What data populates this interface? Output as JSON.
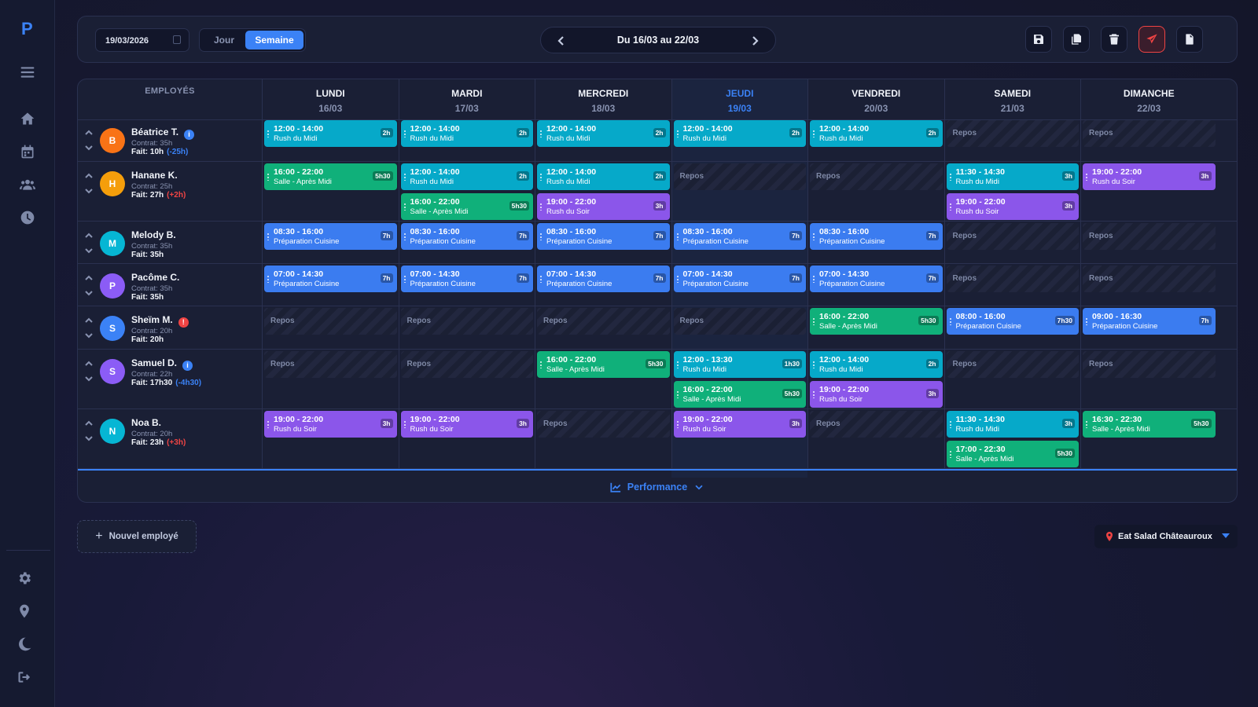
{
  "app": {
    "logo": "P"
  },
  "toolbar": {
    "date_value": "19/03/2026",
    "view_day": "Jour",
    "view_week": "Semaine",
    "week_range": "Du 16/03 au 22/03"
  },
  "grid": {
    "employees_header": "EMPLOYÉS",
    "days": [
      {
        "name": "LUNDI",
        "date": "16/03"
      },
      {
        "name": "MARDI",
        "date": "17/03"
      },
      {
        "name": "MERCREDI",
        "date": "18/03"
      },
      {
        "name": "JEUDI",
        "date": "19/03",
        "today": true
      },
      {
        "name": "VENDREDI",
        "date": "20/03"
      },
      {
        "name": "SAMEDI",
        "date": "21/03"
      },
      {
        "name": "DIMANCHE",
        "date": "22/03"
      }
    ],
    "repos_label": "Repos",
    "employees": [
      {
        "initial": "B",
        "name": "Béatrice T.",
        "badge": "info",
        "avatar_color": "#f97316",
        "contract": "Contrat: 35h",
        "done": "Fait: 10h",
        "diff": "(-25h)",
        "diff_type": "neg",
        "days": [
          [
            {
              "time": "12:00 - 14:00",
              "label": "Rush du Midi",
              "dur": "2h",
              "color": "cyan"
            }
          ],
          [
            {
              "time": "12:00 - 14:00",
              "label": "Rush du Midi",
              "dur": "2h",
              "color": "cyan"
            }
          ],
          [
            {
              "time": "12:00 - 14:00",
              "label": "Rush du Midi",
              "dur": "2h",
              "color": "cyan"
            }
          ],
          [
            {
              "time": "12:00 - 14:00",
              "label": "Rush du Midi",
              "dur": "2h",
              "color": "cyan"
            }
          ],
          [
            {
              "time": "12:00 - 14:00",
              "label": "Rush du Midi",
              "dur": "2h",
              "color": "cyan"
            }
          ],
          "repos",
          "repos"
        ]
      },
      {
        "initial": "H",
        "name": "Hanane K.",
        "badge": "",
        "avatar_color": "#f59e0b",
        "contract": "Contrat: 25h",
        "done": "Fait: 27h",
        "diff": "(+2h)",
        "diff_type": "pos",
        "days": [
          [
            {
              "time": "16:00 - 22:00",
              "label": "Salle - Après Midi",
              "dur": "5h30",
              "color": "green"
            }
          ],
          [
            {
              "time": "12:00 - 14:00",
              "label": "Rush du Midi",
              "dur": "2h",
              "color": "cyan"
            },
            {
              "time": "16:00 - 22:00",
              "label": "Salle - Après Midi",
              "dur": "5h30",
              "color": "green"
            }
          ],
          [
            {
              "time": "12:00 - 14:00",
              "label": "Rush du Midi",
              "dur": "2h",
              "color": "cyan"
            },
            {
              "time": "19:00 - 22:00",
              "label": "Rush du Soir",
              "dur": "3h",
              "color": "purple"
            }
          ],
          "repos",
          "repos",
          [
            {
              "time": "11:30 - 14:30",
              "label": "Rush du Midi",
              "dur": "3h",
              "color": "cyan"
            },
            {
              "time": "19:00 - 22:00",
              "label": "Rush du Soir",
              "dur": "3h",
              "color": "purple"
            }
          ],
          [
            {
              "time": "19:00 - 22:00",
              "label": "Rush du Soir",
              "dur": "3h",
              "color": "purple"
            }
          ]
        ]
      },
      {
        "initial": "M",
        "name": "Melody B.",
        "badge": "",
        "avatar_color": "#06b6d4",
        "contract": "Contrat: 35h",
        "done": "Fait: 35h",
        "diff": "",
        "diff_type": "",
        "days": [
          [
            {
              "time": "08:30 - 16:00",
              "label": "Préparation Cuisine",
              "dur": "7h",
              "color": "blue"
            }
          ],
          [
            {
              "time": "08:30 - 16:00",
              "label": "Préparation Cuisine",
              "dur": "7h",
              "color": "blue"
            }
          ],
          [
            {
              "time": "08:30 - 16:00",
              "label": "Préparation Cuisine",
              "dur": "7h",
              "color": "blue"
            }
          ],
          [
            {
              "time": "08:30 - 16:00",
              "label": "Préparation Cuisine",
              "dur": "7h",
              "color": "blue"
            }
          ],
          [
            {
              "time": "08:30 - 16:00",
              "label": "Préparation Cuisine",
              "dur": "7h",
              "color": "blue"
            }
          ],
          "repos",
          "repos"
        ]
      },
      {
        "initial": "P",
        "name": "Pacôme C.",
        "badge": "",
        "avatar_color": "#8b5cf6",
        "contract": "Contrat: 35h",
        "done": "Fait: 35h",
        "diff": "",
        "diff_type": "",
        "days": [
          [
            {
              "time": "07:00 - 14:30",
              "label": "Préparation Cuisine",
              "dur": "7h",
              "color": "blue"
            }
          ],
          [
            {
              "time": "07:00 - 14:30",
              "label": "Préparation Cuisine",
              "dur": "7h",
              "color": "blue"
            }
          ],
          [
            {
              "time": "07:00 - 14:30",
              "label": "Préparation Cuisine",
              "dur": "7h",
              "color": "blue"
            }
          ],
          [
            {
              "time": "07:00 - 14:30",
              "label": "Préparation Cuisine",
              "dur": "7h",
              "color": "blue"
            }
          ],
          [
            {
              "time": "07:00 - 14:30",
              "label": "Préparation Cuisine",
              "dur": "7h",
              "color": "blue"
            }
          ],
          "repos",
          "repos"
        ]
      },
      {
        "initial": "S",
        "name": "Sheïm M.",
        "badge": "warn",
        "avatar_color": "#3b82f6",
        "contract": "Contrat: 20h",
        "done": "Fait: 20h",
        "diff": "",
        "diff_type": "",
        "days": [
          "repos",
          "repos",
          "repos",
          "repos",
          [
            {
              "time": "16:00 - 22:00",
              "label": "Salle - Après Midi",
              "dur": "5h30",
              "color": "green"
            }
          ],
          [
            {
              "time": "08:00 - 16:00",
              "label": "Préparation Cuisine",
              "dur": "7h30",
              "color": "blue"
            }
          ],
          [
            {
              "time": "09:00 - 16:30",
              "label": "Préparation Cuisine",
              "dur": "7h",
              "color": "blue"
            }
          ]
        ]
      },
      {
        "initial": "S",
        "name": "Samuel D.",
        "badge": "info",
        "avatar_color": "#8b5cf6",
        "contract": "Contrat: 22h",
        "done": "Fait: 17h30",
        "diff": "(-4h30)",
        "diff_type": "neg",
        "days": [
          "repos",
          "repos",
          [
            {
              "time": "16:00 - 22:00",
              "label": "Salle - Après Midi",
              "dur": "5h30",
              "color": "green"
            }
          ],
          [
            {
              "time": "12:00 - 13:30",
              "label": "Rush du Midi",
              "dur": "1h30",
              "color": "cyan"
            },
            {
              "time": "16:00 - 22:00",
              "label": "Salle - Après Midi",
              "dur": "5h30",
              "color": "green"
            }
          ],
          [
            {
              "time": "12:00 - 14:00",
              "label": "Rush du Midi",
              "dur": "2h",
              "color": "cyan"
            },
            {
              "time": "19:00 - 22:00",
              "label": "Rush du Soir",
              "dur": "3h",
              "color": "purple"
            }
          ],
          "repos",
          "repos"
        ]
      },
      {
        "initial": "N",
        "name": "Noa B.",
        "badge": "",
        "avatar_color": "#06b6d4",
        "contract": "Contrat: 20h",
        "done": "Fait: 23h",
        "diff": "(+3h)",
        "diff_type": "pos",
        "days": [
          [
            {
              "time": "19:00 - 22:00",
              "label": "Rush du Soir",
              "dur": "3h",
              "color": "purple"
            }
          ],
          [
            {
              "time": "19:00 - 22:00",
              "label": "Rush du Soir",
              "dur": "3h",
              "color": "purple"
            }
          ],
          "repos",
          [
            {
              "time": "19:00 - 22:00",
              "label": "Rush du Soir",
              "dur": "3h",
              "color": "purple"
            }
          ],
          "repos",
          [
            {
              "time": "11:30 - 14:30",
              "label": "Rush du Midi",
              "dur": "3h",
              "color": "cyan"
            },
            {
              "time": "17:00 - 22:30",
              "label": "Salle - Après Midi",
              "dur": "5h30",
              "color": "green"
            }
          ],
          [
            {
              "time": "16:30 - 22:30",
              "label": "Salle - Après Midi",
              "dur": "5h30",
              "color": "green"
            }
          ]
        ]
      }
    ]
  },
  "performance": {
    "label": "Performance"
  },
  "footer": {
    "new_employee": "Nouvel employé",
    "location": "Eat Salad Châteauroux"
  },
  "colors": {
    "accent": "#3b82f6",
    "danger": "#ef4444",
    "cyan": "#06a9c9",
    "blue": "#3b7cf0",
    "green": "#10b07a",
    "purple": "#8b56ea"
  }
}
